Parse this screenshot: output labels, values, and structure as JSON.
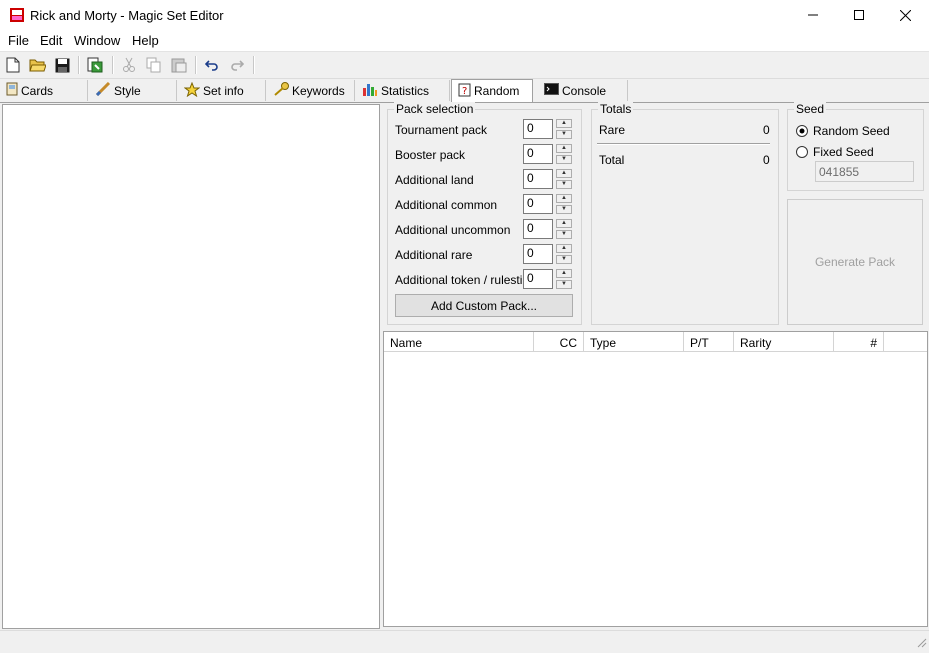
{
  "window": {
    "title": "Rick and Morty - Magic Set Editor"
  },
  "menu": [
    "File",
    "Edit",
    "Window",
    "Help"
  ],
  "toolbar": {
    "icons": [
      "new-icon",
      "open-icon",
      "save-icon",
      "export-icon",
      "cut-icon",
      "copy-icon",
      "paste-icon",
      "undo-icon",
      "redo-icon"
    ]
  },
  "tabs": [
    {
      "label": "Cards",
      "icon": "cards-icon"
    },
    {
      "label": "Style",
      "icon": "brush-icon"
    },
    {
      "label": "Set info",
      "icon": "star-icon"
    },
    {
      "label": "Keywords",
      "icon": "key-icon"
    },
    {
      "label": "Statistics",
      "icon": "bar-chart-icon"
    },
    {
      "label": "Random",
      "icon": "dice-icon",
      "active": true
    },
    {
      "label": "Console",
      "icon": "console-icon"
    }
  ],
  "pack_selection": {
    "title": "Pack selection",
    "rows": [
      {
        "label": "Tournament pack",
        "value": "0"
      },
      {
        "label": "Booster pack",
        "value": "0"
      },
      {
        "label": "Additional land",
        "value": "0"
      },
      {
        "label": "Additional common",
        "value": "0"
      },
      {
        "label": "Additional uncommon",
        "value": "0"
      },
      {
        "label": "Additional rare",
        "value": "0"
      },
      {
        "label": "Additional token / rulestip",
        "value": "0"
      }
    ],
    "add_button": "Add Custom Pack..."
  },
  "totals": {
    "title": "Totals",
    "rare_label": "Rare",
    "rare_value": "0",
    "total_label": "Total",
    "total_value": "0"
  },
  "seed": {
    "title": "Seed",
    "random_label": "Random Seed",
    "fixed_label": "Fixed Seed",
    "selected": "random",
    "fixed_value": "041855"
  },
  "generate_button": "Generate Pack",
  "columns": [
    "Name",
    "CC",
    "Type",
    "P/T",
    "Rarity",
    "#"
  ],
  "colors": {
    "accent": "#0078d7",
    "window": "#f0f0f0",
    "panel": "#ffffff"
  }
}
